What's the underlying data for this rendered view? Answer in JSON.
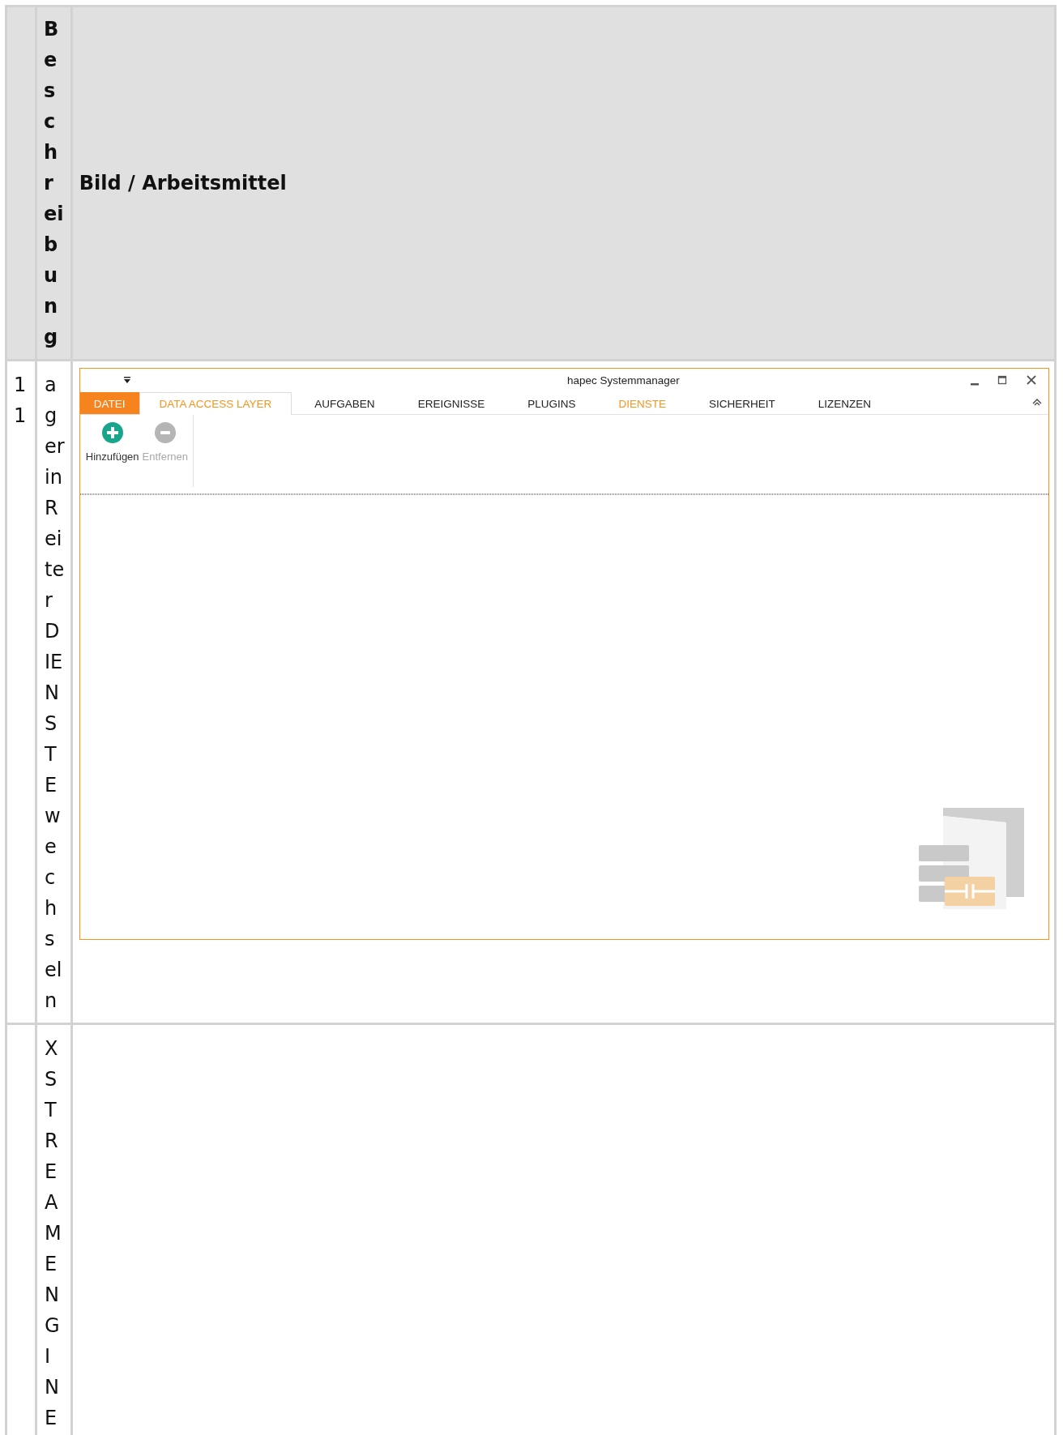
{
  "table": {
    "header": {
      "column_2": "Beschreibung",
      "column_3": "Bild / Arbeitsmittel"
    },
    "rows": [
      {
        "column_1": "11",
        "column_2": "agerin Reiter DIENSTE wechseln",
        "column_3": {
          "kind": "app_window",
          "window": {
            "title": "hapec Systemmanager"
          },
          "tabs": [
            {
              "label": "DATEI",
              "kind": "file",
              "selected": false
            },
            {
              "label": "DATA ACCESS LAYER",
              "kind": "tab",
              "selected": true,
              "highlighted": true
            },
            {
              "label": "AUFGABEN",
              "kind": "tab",
              "selected": false,
              "highlighted": false
            },
            {
              "label": "EREIGNISSE",
              "kind": "tab",
              "selected": false,
              "highlighted": false
            },
            {
              "label": "PLUGINS",
              "kind": "tab",
              "selected": false,
              "highlighted": false
            },
            {
              "label": "DIENSTE",
              "kind": "tab",
              "selected": false,
              "highlighted": true
            },
            {
              "label": "SICHERHEIT",
              "kind": "tab",
              "selected": false,
              "highlighted": false
            },
            {
              "label": "LIZENZEN",
              "kind": "tab",
              "selected": false,
              "highlighted": false
            }
          ],
          "ribbon": {
            "buttons": [
              {
                "label": "Hinzufügen",
                "kind": "add",
                "disabled": false
              },
              {
                "label": "Entfernen",
                "kind": "remove",
                "disabled": true
              }
            ]
          }
        }
      },
      {
        "column_2": "XSTREAMENGINE"
      }
    ]
  }
}
